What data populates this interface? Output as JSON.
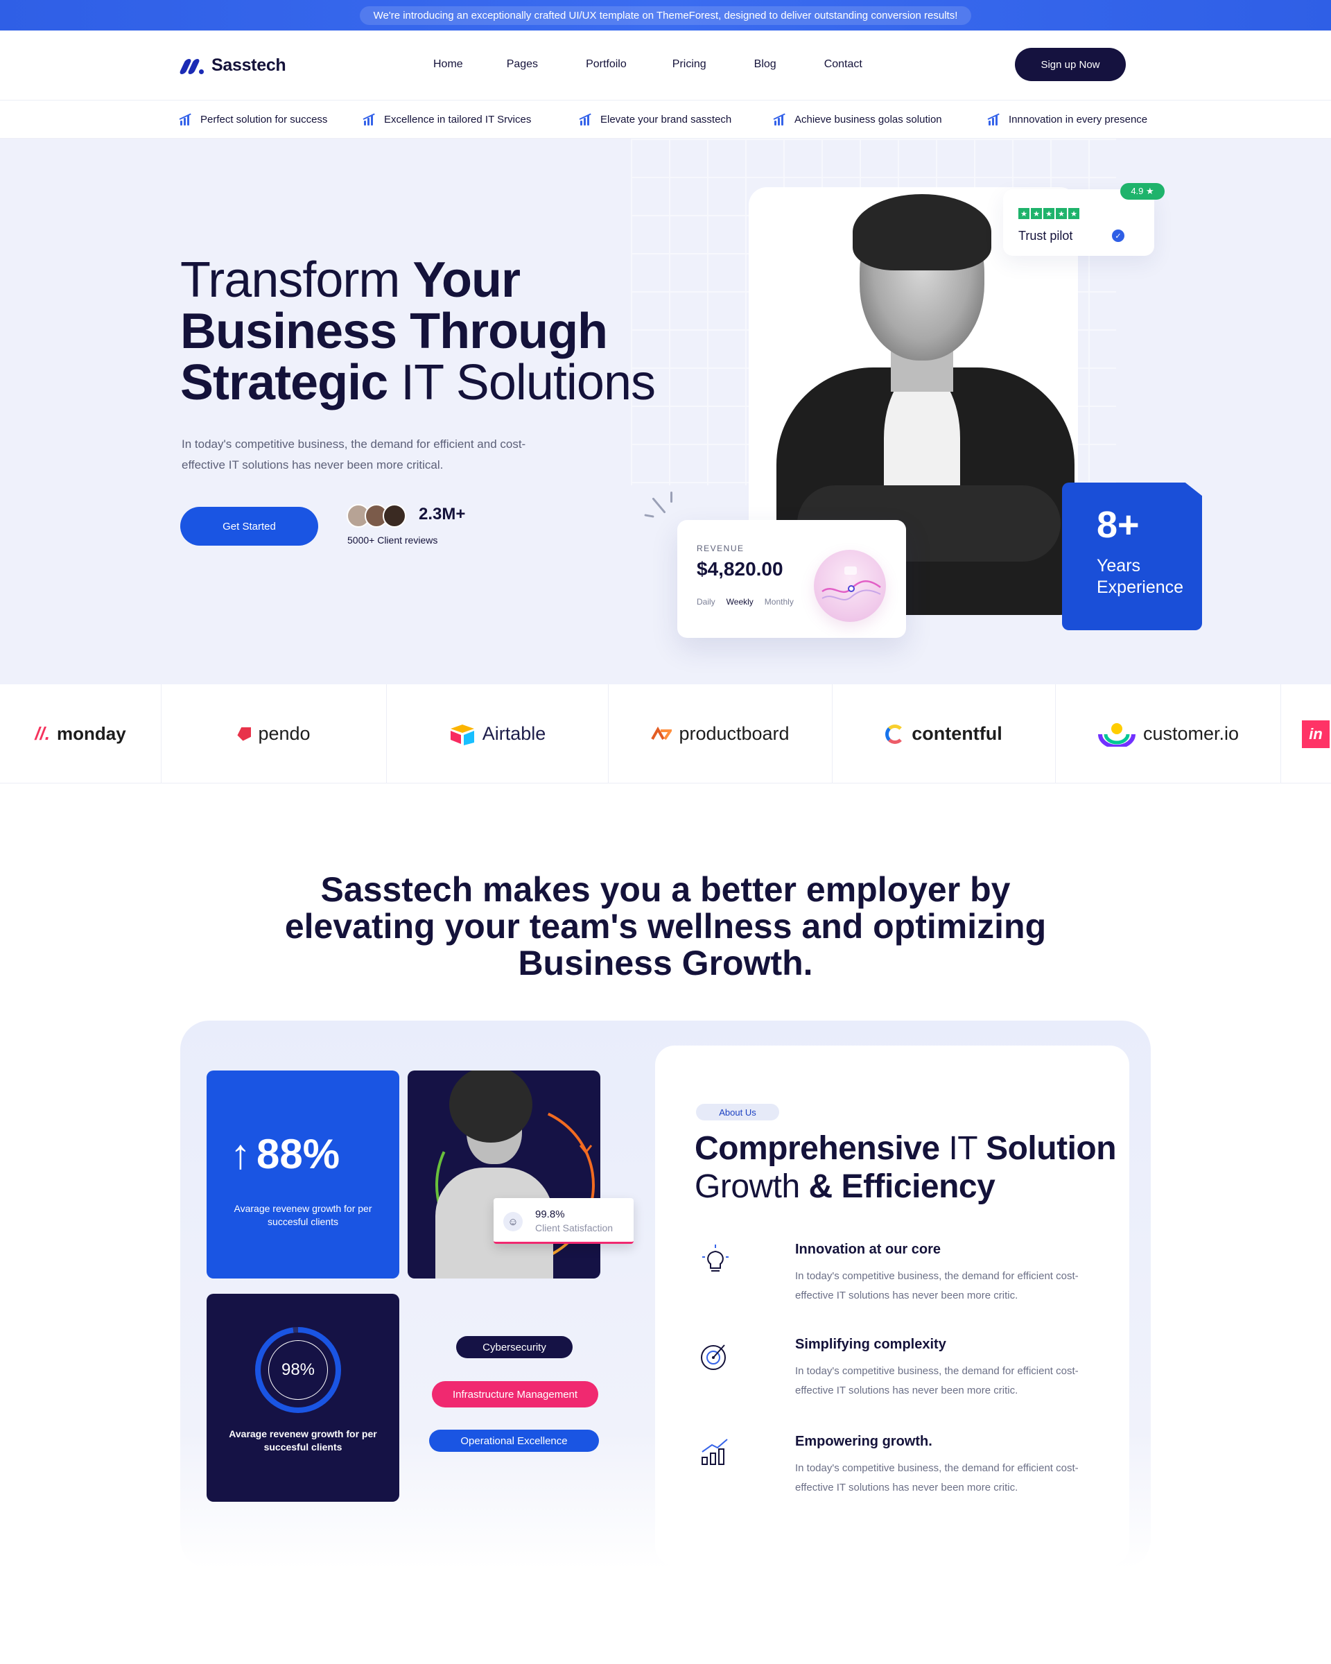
{
  "announcement": "We're introducing an exceptionally crafted UI/UX template on ThemeForest, designed to deliver outstanding conversion results!",
  "brand": {
    "name": "Sasstech"
  },
  "nav": {
    "items": [
      "Home",
      "Pages",
      "Portfoilo",
      "Pricing",
      "Blog",
      "Contact"
    ],
    "cta": "Sign up Now"
  },
  "features_strip": [
    "Perfect solution for success",
    "Excellence in tailored IT Srvices",
    "Elevate your brand sasstech",
    "Achieve business golas solution",
    "Innnovation in every presence"
  ],
  "hero": {
    "title_1": "Transform ",
    "title_2": "Your Business Through Strategic",
    "title_3": " IT Solutions",
    "description": "In today's competitive business, the demand for efficient and cost-effective IT solutions has never been more critical.",
    "cta": "Get Started",
    "reviews_count": "2.3M+",
    "reviews_label": "5000+ Client reviews",
    "trust": {
      "label": "Trust pilot",
      "rating": "4.9 ★",
      "stars": 5
    },
    "revenue": {
      "label": "REVENUE",
      "value": "$4,820.00",
      "tabs": [
        "Daily",
        "Weekly",
        "Monthly"
      ],
      "active_tab": "Weekly"
    },
    "experience": {
      "number": "8+",
      "label_1": "Years",
      "label_2": "Experience"
    }
  },
  "partners": [
    "monday",
    "pendo",
    "Airtable",
    "productboard",
    "contentful",
    "customer.io",
    "in"
  ],
  "section2": {
    "heading_1": "Sasstech",
    "heading_2": " makes you a better employer by elevating your team's wellness and optimizing Business ",
    "heading_3": "Growth."
  },
  "stats": {
    "growth_value": "88%",
    "growth_arrow": "↑",
    "growth_desc": "Avarage revenew growth for per succesful clients",
    "satisfaction_value": "99.8%",
    "satisfaction_label": "Client Satisfaction",
    "ring_value": "98%",
    "ring_fraction": 0.98,
    "ring_desc": "Avarage revenew growth for per succesful clients",
    "tags": [
      "Cybersecurity",
      "Infrastructure Management",
      "Operational Excellence"
    ]
  },
  "about": {
    "badge": "About Us",
    "title_1": "Comprehensive",
    "title_2": " IT ",
    "title_3": "Solution",
    "title_4": "Growth ",
    "title_5": "& Efficiency",
    "features": [
      {
        "icon": "lightbulb-icon",
        "title": "Innovation at our core",
        "desc": "In today's competitive business, the demand for efficient cost-effective IT solutions has never been more critic."
      },
      {
        "icon": "target-icon",
        "title": "Simplifying complexity",
        "desc": "In today's competitive business, the demand for efficient cost-effective IT solutions has never been more critic."
      },
      {
        "icon": "growth-chart-icon",
        "title": "Empowering growth.",
        "desc": "In today's competitive business, the demand for efficient cost-effective IT solutions has never been more critic."
      }
    ]
  },
  "colors": {
    "primary": "#1a55e3",
    "navy": "#151245",
    "pink": "#f02970",
    "green": "#1fb36b"
  }
}
